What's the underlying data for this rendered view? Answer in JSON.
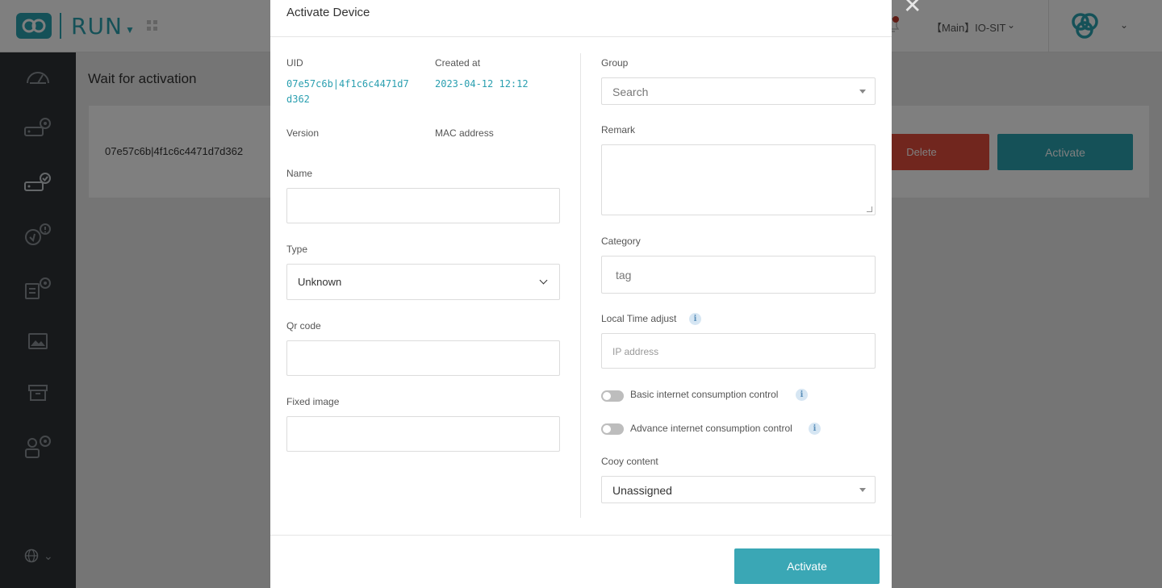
{
  "app": {
    "name": "RUN",
    "environment": "【Main】IO-SIT"
  },
  "sidebar": {
    "items": [
      {
        "icon": "dashboard-icon"
      },
      {
        "icon": "device-settings-icon"
      },
      {
        "icon": "device-activation-icon"
      },
      {
        "icon": "device-alert-icon"
      },
      {
        "icon": "report-settings-icon"
      },
      {
        "icon": "image-icon"
      },
      {
        "icon": "archive-icon"
      },
      {
        "icon": "user-settings-icon"
      }
    ],
    "language_icon": "globe-icon"
  },
  "page": {
    "title": "Wait for activation",
    "device_uid": "07e57c6b|4f1c6c4471d7d362",
    "delete_label": "Delete",
    "activate_label": "Activate"
  },
  "modal": {
    "title": "Activate Device",
    "uid_label": "UID",
    "uid_line1": "07e57c6b|4f1c6c4471d7",
    "uid_line2": "d362",
    "created_label": "Created at",
    "created_value": "2023-04-12 12:12",
    "version_label": "Version",
    "mac_label": "MAC address",
    "name_label": "Name",
    "name_value": "",
    "type_label": "Type",
    "type_value": "Unknown",
    "qr_label": "Qr code",
    "qr_value": "",
    "fixed_image_label": "Fixed image",
    "fixed_image_value": "",
    "group_label": "Group",
    "group_placeholder": "Search",
    "remark_label": "Remark",
    "remark_value": "",
    "category_label": "Category",
    "category_placeholder": "tag",
    "time_adjust_label": "Local Time adjust",
    "ip_placeholder": "IP address",
    "basic_control_label": "Basic internet consumption control",
    "basic_control_on": false,
    "advance_control_label": "Advance internet consumption control",
    "advance_control_on": false,
    "copy_content_label": "Cooy content",
    "copy_content_value": "Unassigned",
    "submit_label": "Activate",
    "info_glyph": "i"
  },
  "colors": {
    "accent": "#2aa3b0",
    "danger": "#e34c3d",
    "sidebar": "#2f3336"
  }
}
